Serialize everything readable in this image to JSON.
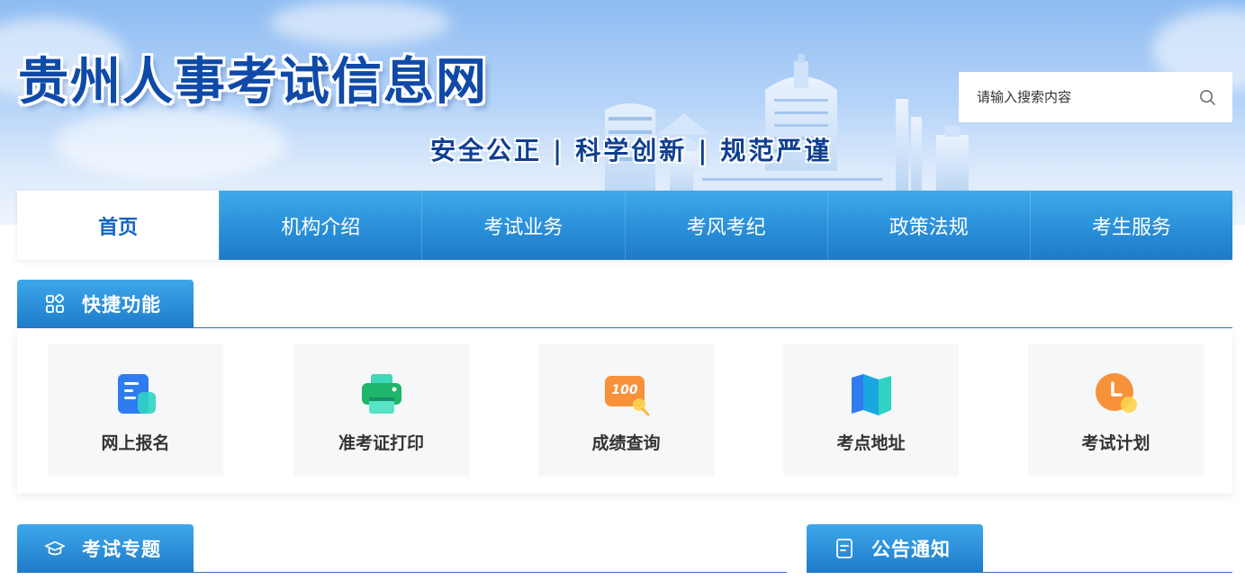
{
  "header": {
    "site_title": "贵州人事考试信息网",
    "slogan": [
      "安全公正",
      "科学创新",
      "规范严谨"
    ],
    "slogan_separator": "|"
  },
  "search": {
    "placeholder": "请输入搜索内容",
    "icon": "search-icon"
  },
  "nav": {
    "items": [
      {
        "label": "首页",
        "active": true
      },
      {
        "label": "机构介绍",
        "active": false
      },
      {
        "label": "考试业务",
        "active": false
      },
      {
        "label": "考风考纪",
        "active": false
      },
      {
        "label": "政策法规",
        "active": false
      },
      {
        "label": "考生服务",
        "active": false
      }
    ]
  },
  "quick": {
    "title": "快捷功能",
    "icon": "grid-icon",
    "items": [
      {
        "label": "网上报名",
        "icon": "online-registration-icon"
      },
      {
        "label": "准考证打印",
        "icon": "printer-icon"
      },
      {
        "label": "成绩查询",
        "icon": "score-query-icon",
        "icon_text": "100"
      },
      {
        "label": "考点地址",
        "icon": "map-icon"
      },
      {
        "label": "考试计划",
        "icon": "clock-icon"
      }
    ]
  },
  "sections": {
    "exam_topics": {
      "title": "考试专题",
      "icon": "graduation-cap-icon"
    },
    "notices": {
      "title": "公告通知",
      "icon": "document-icon"
    }
  },
  "colors": {
    "primary_blue": "#1f7ccb",
    "nav_blue": "#2a8fd8",
    "title_blue": "#0f4aa8",
    "active_text": "#1565c0"
  }
}
